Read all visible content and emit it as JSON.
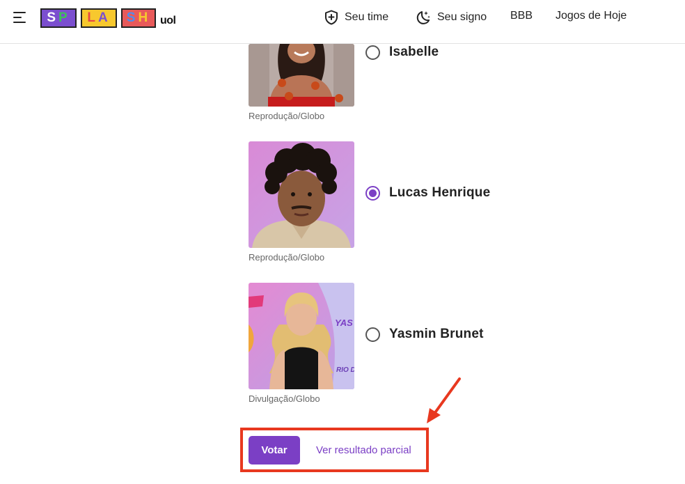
{
  "header": {
    "logo": {
      "blocks": [
        [
          "S",
          "P"
        ],
        [
          "L",
          "A"
        ],
        [
          "S",
          "H"
        ]
      ],
      "suffix": "uol"
    },
    "nav": [
      {
        "label": "Seu time",
        "icon": "shield-plus-icon"
      },
      {
        "label": "Seu signo",
        "icon": "moon-stars-icon"
      },
      {
        "label": "BBB"
      },
      {
        "label": "Jogos de Hoje"
      }
    ]
  },
  "poll": {
    "options": [
      {
        "name": "Isabelle",
        "credit": "Reprodução/Globo",
        "selected": false
      },
      {
        "name": "Lucas Henrique",
        "credit": "Reprodução/Globo",
        "selected": true
      },
      {
        "name": "Yasmin Brunet",
        "credit": "Divulgação/Globo",
        "selected": false
      }
    ],
    "vote_label": "Votar",
    "partial_label": "Ver resultado parcial"
  },
  "colors": {
    "accent": "#7b3fc5",
    "highlight": "#e8381f"
  }
}
